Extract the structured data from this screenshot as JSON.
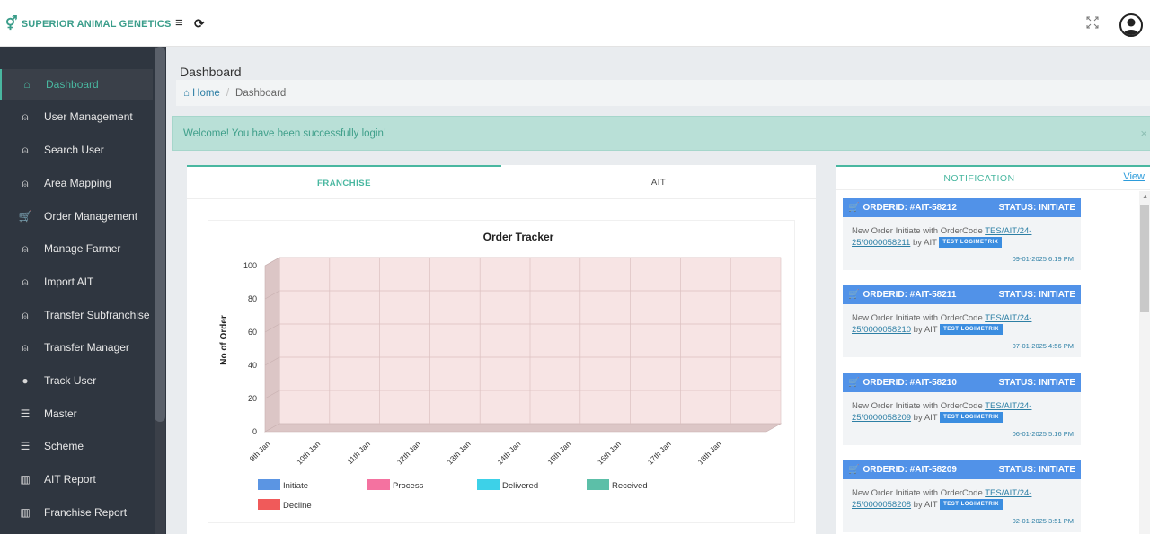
{
  "header": {
    "brand": "SUPERIOR ANIMAL GENETICS",
    "logo_icon": "gender-symbol-icon",
    "menu_icon": "≡",
    "refresh_icon": "⟳"
  },
  "sidebar": {
    "items": [
      {
        "label": "Dashboard",
        "icon": "⌂",
        "active": true
      },
      {
        "label": "User Management",
        "icon": "⍝"
      },
      {
        "label": "Search User",
        "icon": "⍝"
      },
      {
        "label": "Area Mapping",
        "icon": "⍝"
      },
      {
        "label": "Order Management",
        "icon": "🛒"
      },
      {
        "label": "Manage Farmer",
        "icon": "⍝"
      },
      {
        "label": "Import AIT",
        "icon": "⍝"
      },
      {
        "label": "Transfer Subfranchise",
        "icon": "⍝"
      },
      {
        "label": "Transfer Manager",
        "icon": "⍝"
      },
      {
        "label": "Track User",
        "icon": "●"
      },
      {
        "label": "Master",
        "icon": "☰"
      },
      {
        "label": "Scheme",
        "icon": "☰"
      },
      {
        "label": "AIT Report",
        "icon": "▥"
      },
      {
        "label": "Franchise Report",
        "icon": "▥"
      }
    ]
  },
  "page": {
    "title": "Dashboard",
    "breadcrumb_home": "Home",
    "breadcrumb_current": "Dashboard",
    "alert": "Welcome! You have been successfully login!",
    "alert_close": "×"
  },
  "tabs": [
    {
      "label": "FRANCHISE",
      "active": true
    },
    {
      "label": "AIT",
      "active": false
    }
  ],
  "chart_data": {
    "type": "bar",
    "title": "Order Tracker",
    "ylabel": "No of Order",
    "xlabel": "",
    "ylim": [
      0,
      100
    ],
    "yticks": [
      0,
      20,
      40,
      60,
      80,
      100
    ],
    "categories": [
      "9th Jan",
      "10th Jan",
      "11th Jan",
      "12th Jan",
      "13th Jan",
      "14th Jan",
      "15th Jan",
      "16th Jan",
      "17th Jan",
      "18th Jan"
    ],
    "series": [
      {
        "name": "Initiate",
        "color": "#5b95e3",
        "values": [
          0,
          0,
          0,
          0,
          0,
          0,
          0,
          0,
          0,
          0
        ]
      },
      {
        "name": "Process",
        "color": "#f472a0",
        "values": [
          0,
          0,
          0,
          0,
          0,
          0,
          0,
          0,
          0,
          0
        ]
      },
      {
        "name": "Delivered",
        "color": "#3dd1e8",
        "values": [
          0,
          0,
          0,
          0,
          0,
          0,
          0,
          0,
          0,
          0
        ]
      },
      {
        "name": "Received",
        "color": "#5cbfa8",
        "values": [
          0,
          0,
          0,
          0,
          0,
          0,
          0,
          0,
          0,
          0
        ]
      },
      {
        "name": "Decline",
        "color": "#f05a5a",
        "values": [
          0,
          0,
          0,
          0,
          0,
          0,
          0,
          0,
          0,
          0
        ]
      }
    ],
    "grid": true,
    "legend": "bottom"
  },
  "notifications": {
    "title": "NOTIFICATION",
    "view_label": "View",
    "items": [
      {
        "order": "ORDERID: #AIT-58212",
        "status": "STATUS: INITIATE",
        "text_pre": "New Order Initiate with OrderCode ",
        "code": "TES/AIT/24-25/0000058211",
        "text_post": " by AIT",
        "badge": "TEST LOGIMETRIX",
        "date": "09-01-2025 6:19 PM"
      },
      {
        "order": "ORDERID: #AIT-58211",
        "status": "STATUS: INITIATE",
        "text_pre": "New Order Initiate with OrderCode ",
        "code": "TES/AIT/24-25/0000058210",
        "text_post": " by AIT",
        "badge": "TEST LOGIMETRIX",
        "date": "07-01-2025 4:56 PM"
      },
      {
        "order": "ORDERID: #AIT-58210",
        "status": "STATUS: INITIATE",
        "text_pre": "New Order Initiate with OrderCode ",
        "code": "TES/AIT/24-25/0000058209",
        "text_post": " by AIT",
        "badge": "TEST LOGIMETRIX",
        "date": "06-01-2025 5:16 PM"
      },
      {
        "order": "ORDERID: #AIT-58209",
        "status": "STATUS: INITIATE",
        "text_pre": "New Order Initiate with OrderCode ",
        "code": "TES/AIT/24-25/0000058208",
        "text_post": " by AIT",
        "badge": "TEST LOGIMETRIX",
        "date": "02-01-2025 3:51 PM"
      }
    ]
  }
}
